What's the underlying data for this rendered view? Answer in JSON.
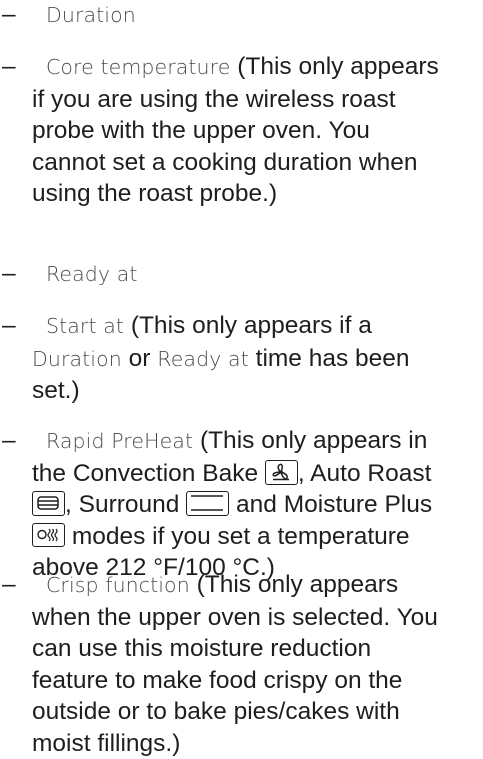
{
  "options": [
    {
      "display": "Duration"
    },
    {
      "display": "Core temperature",
      "note_line1": "(This only appears",
      "note_rest": [
        "if you are using the wireless roast",
        "probe with the upper oven. You",
        "cannot set a cooking duration when",
        "using the roast probe.)"
      ]
    },
    {
      "display": "Ready at"
    },
    {
      "display": "Start at",
      "note_line1": "(This only appears if a",
      "line2_display_a": "Duration",
      "line2_or": "or",
      "line2_display_b": "Ready at",
      "line2_tail": "time has been",
      "line3": "set.)"
    },
    {
      "display": "Rapid PreHeat",
      "note_line1": "(This only appears in",
      "line2_pre": "the Convection Bake",
      "line2_post": ", Auto Roast",
      "line3_mid": ", Surround",
      "line3_post": "and Moisture Plus",
      "line4_post": "modes if you set a temperature",
      "line5": "above 212 °F/100 °C.)",
      "icons": [
        "convection-bake-icon",
        "auto-roast-icon",
        "surround-icon",
        "moisture-plus-icon"
      ]
    },
    {
      "display": "Crisp function",
      "note_line1": "(This only appears",
      "note_rest": [
        "when the upper oven is selected. You",
        "can use this moisture reduction",
        "feature to make food crispy on the",
        "outside or to bake pies/cakes with",
        "moist fillings.)"
      ]
    }
  ]
}
